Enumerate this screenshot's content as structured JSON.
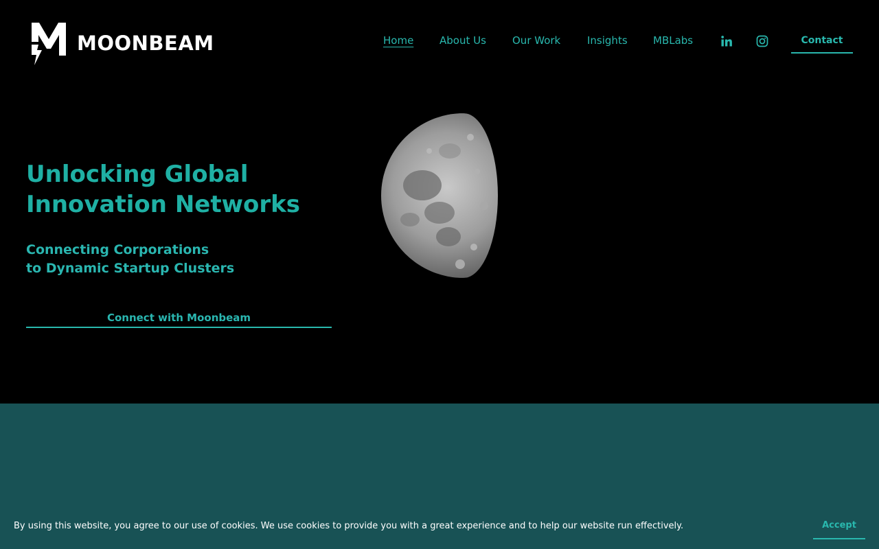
{
  "brand": {
    "name": "MOONBEAM",
    "logo_icon": "moonbeam-m-bolt-logo"
  },
  "nav": {
    "items": [
      {
        "label": "Home",
        "active": true
      },
      {
        "label": "About Us"
      },
      {
        "label": "Our Work"
      },
      {
        "label": "Insights"
      },
      {
        "label": "MBLabs"
      }
    ],
    "social": [
      {
        "icon": "linkedin-icon"
      },
      {
        "icon": "instagram-icon"
      }
    ],
    "contact_label": "Contact"
  },
  "hero": {
    "headline_line1": "Unlocking Global",
    "headline_line2": "Innovation Networks",
    "sub_line1": "Connecting Corporations",
    "sub_line2": "to Dynamic Startup Clusters",
    "cta_label": "Connect with Moonbeam",
    "image": "half-moon-photo"
  },
  "cookie": {
    "text": "By using this website, you agree to our use of cookies. We use cookies to provide you with a great experience and to help our website run effectively.",
    "accept_label": "Accept"
  },
  "colors": {
    "accent": "#29b8ae",
    "background": "#000000",
    "lower_section": "#185255"
  }
}
